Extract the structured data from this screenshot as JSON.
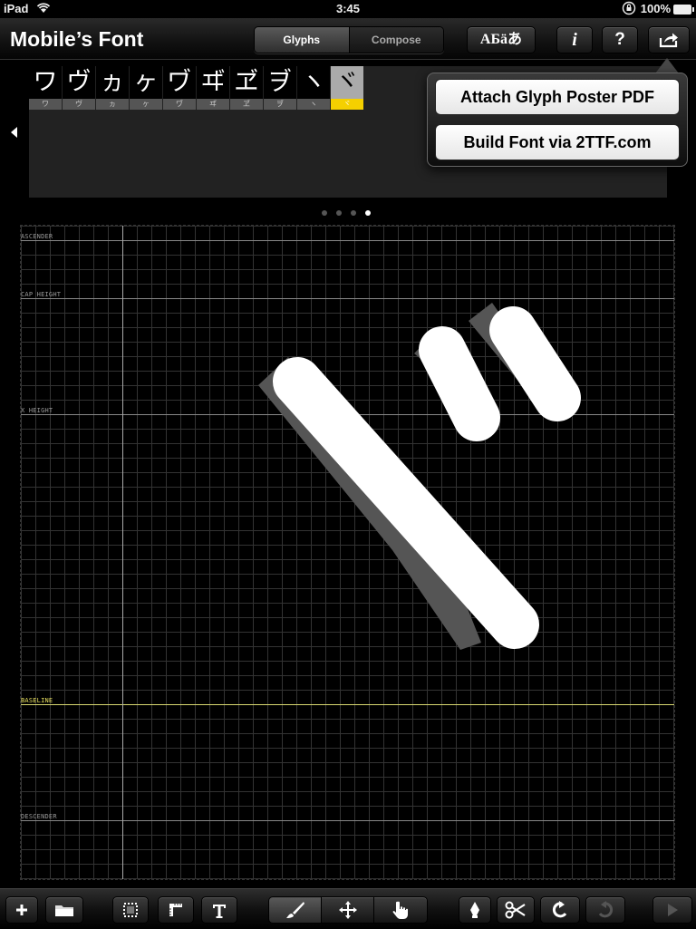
{
  "status_bar": {
    "carrier": "iPad",
    "time": "3:45",
    "battery": "100%"
  },
  "nav": {
    "title": "Mobile’s Font",
    "segments": [
      {
        "label": "Glyphs",
        "selected": true
      },
      {
        "label": "Compose",
        "selected": false
      }
    ],
    "scripts_label": "АБäあ",
    "info_label": "i",
    "help_label": "?"
  },
  "glyph_strip": {
    "glyphs": [
      {
        "char": "ワ",
        "label": "ワ"
      },
      {
        "char": "ヴ",
        "label": "ヴ"
      },
      {
        "char": "ヵ",
        "label": "ヵ"
      },
      {
        "char": "ヶ",
        "label": "ヶ"
      },
      {
        "char": "ヷ",
        "label": "ヷ"
      },
      {
        "char": "ヸ",
        "label": "ヸ"
      },
      {
        "char": "ヹ",
        "label": "ヹ"
      },
      {
        "char": "ヺ",
        "label": "ヺ"
      },
      {
        "char": "ヽ",
        "label": "ヽ"
      },
      {
        "char": "ヾ",
        "label": "ヾ",
        "selected": true
      }
    ],
    "pages": 4,
    "active_page": 4
  },
  "share_popover": {
    "attach_label": "Attach Glyph Poster PDF",
    "build_label": "Build Font via 2TTF.com"
  },
  "canvas": {
    "guides": [
      {
        "label": "ASCENDER"
      },
      {
        "label": "CAP HEIGHT"
      },
      {
        "label": "X HEIGHT"
      },
      {
        "label": "BASELINE"
      },
      {
        "label": "DESCENDER"
      }
    ]
  },
  "colors": {
    "selected_glyph": "#f5d000",
    "baseline": "#d8d870",
    "stroke": "#ffffff"
  }
}
